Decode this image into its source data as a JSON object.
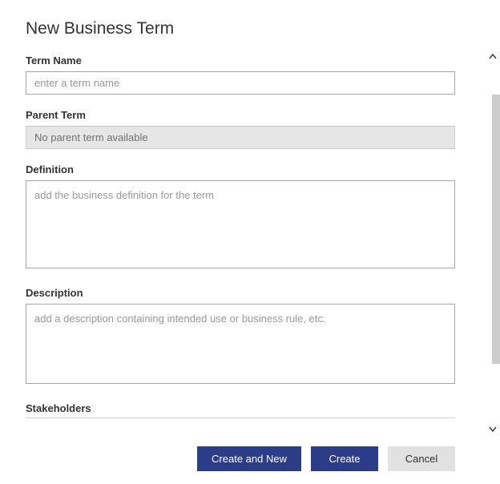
{
  "title": "New Business Term",
  "fields": {
    "termName": {
      "label": "Term Name",
      "placeholder": "enter a term name",
      "value": ""
    },
    "parentTerm": {
      "label": "Parent Term",
      "value": "No parent term available"
    },
    "definition": {
      "label": "Definition",
      "placeholder": "add the business definition for the term",
      "value": ""
    },
    "description": {
      "label": "Description",
      "placeholder": "add a description containing intended use or business rule, etc.",
      "value": ""
    }
  },
  "sections": {
    "stakeholders": "Stakeholders"
  },
  "buttons": {
    "createAndNew": "Create and New",
    "create": "Create",
    "cancel": "Cancel"
  }
}
